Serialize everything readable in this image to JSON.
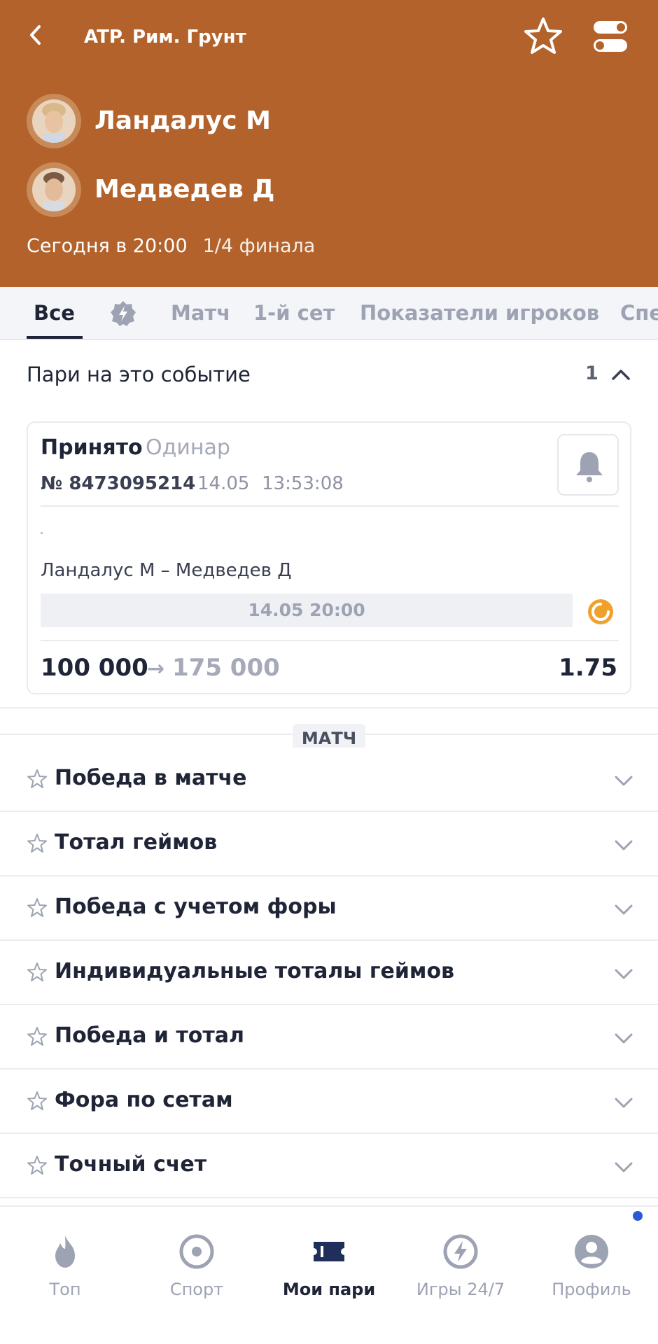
{
  "header": {
    "league": "ATP. Рим. Грунт",
    "player1": "Ландалус М",
    "player2": "Медведев Д",
    "start_time": "Сегодня в 20:00",
    "stage": "1/4 финала",
    "bg_color": "#b2622a"
  },
  "tabs": [
    {
      "label": "Все",
      "active": true
    },
    {
      "icon": "lightning-badge-icon"
    },
    {
      "label": "Матч"
    },
    {
      "label": "1-й сет"
    },
    {
      "label": "Показатели игроков"
    },
    {
      "label": "Спе"
    }
  ],
  "bets": {
    "title": "Пари на это событие",
    "count": "1",
    "card": {
      "status": "Принято",
      "type": "Одинар",
      "number": "№ 8473095214",
      "date": "14.05",
      "time": "13:53:08",
      "match": "Ландалус М – Медведев Д",
      "event_time": "14.05 20:00",
      "stake": "100 000",
      "arrow": "→",
      "win": "175 000",
      "odds": "1.75"
    }
  },
  "section_badge": "МАТЧ",
  "markets": [
    "Победа в матче",
    "Тотал геймов",
    "Победа с учетом форы",
    "Индивидуальные тоталы геймов",
    "Победа и тотал",
    "Фора по сетам",
    "Точный счет"
  ],
  "bottom_nav": [
    {
      "label": "Топ",
      "icon": "flame-icon"
    },
    {
      "label": "Спорт",
      "icon": "sport-icon"
    },
    {
      "label": "Мои пари",
      "icon": "ticket-icon",
      "active": true
    },
    {
      "label": "Игры 24/7",
      "icon": "lightning-icon"
    },
    {
      "label": "Профиль",
      "icon": "profile-icon",
      "has_notification": true
    }
  ],
  "colors": {
    "accent": "#1f2437",
    "muted": "#9ea3b3",
    "live": "#f0a12b",
    "notification": "#2a5bd7"
  }
}
